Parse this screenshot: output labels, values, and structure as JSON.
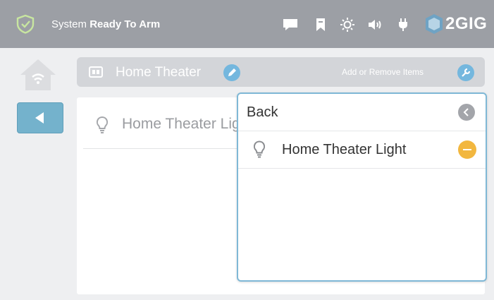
{
  "status": {
    "prefix": "System",
    "main": "Ready To Arm"
  },
  "brand": {
    "logo_text": "2GIG"
  },
  "header": {
    "room_name": "Home Theater",
    "add_remove_label": "Add or Remove Items"
  },
  "list": {
    "items": [
      {
        "label": "Home Theater Light"
      }
    ]
  },
  "popup": {
    "back_label": "Back",
    "items": [
      {
        "label": "Home Theater Light"
      }
    ]
  },
  "colors": {
    "accent": "#74b7de",
    "remove": "#f2b73f",
    "topbar": "#9c9fa5"
  }
}
